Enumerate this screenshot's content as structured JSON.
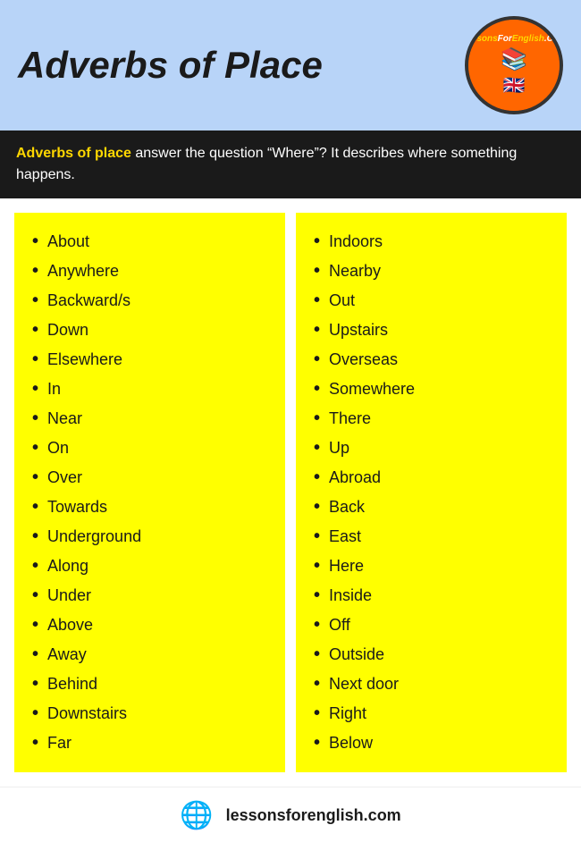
{
  "header": {
    "title": "Adverbs of Place",
    "logo": {
      "text_top": "LessonsForEnglish.Com",
      "books_icon": "📚",
      "flag_icon": "🇬🇧",
      "text_bottom": ".Com"
    }
  },
  "description": {
    "highlight": "Adverbs of place",
    "rest": " answer the question “Where”? It describes where something happens."
  },
  "columns": {
    "left": [
      "About",
      "Anywhere",
      "Backward/s",
      "Down",
      "Elsewhere",
      "In",
      "Near",
      "On",
      "Over",
      "Towards",
      "Underground",
      "Along",
      "Under",
      "Above",
      "Away",
      "Behind",
      "Downstairs",
      "Far"
    ],
    "right": [
      "Indoors",
      "Nearby",
      "Out",
      "Upstairs",
      "Overseas",
      "Somewhere",
      "There",
      "Up",
      "Abroad",
      "Back",
      "East",
      "Here",
      "Inside",
      "Off",
      "Outside",
      "Next door",
      "Right",
      "Below"
    ]
  },
  "footer": {
    "url": "lessonsforenglish.com",
    "globe_icon": "🌐"
  }
}
